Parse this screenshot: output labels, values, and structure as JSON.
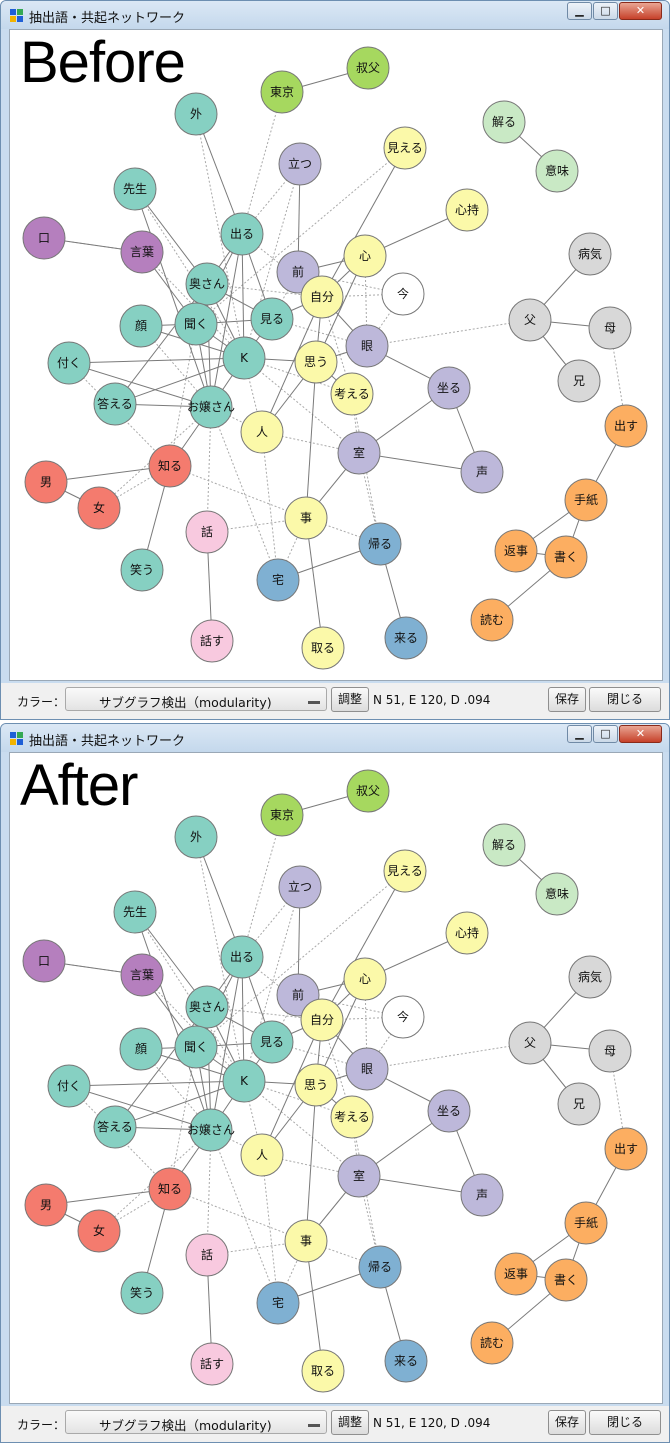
{
  "windows": [
    {
      "title": "抽出語・共起ネットワーク",
      "caption": "Before",
      "controls": {
        "minimize": "▁",
        "maximize": "□",
        "close": "✕"
      },
      "bottom": {
        "color_label": "カラー：",
        "color_value": "サブグラフ検出（modularity)",
        "adjust": "調整",
        "status": "N 51, E 120, D .094",
        "save": "保存",
        "close": "閉じる"
      }
    },
    {
      "title": "抽出語・共起ネットワーク",
      "caption": "After",
      "controls": {
        "minimize": "▁",
        "maximize": "□",
        "close": "✕"
      },
      "bottom": {
        "color_label": "カラー：",
        "color_value": "サブグラフ検出（modularity)",
        "adjust": "調整",
        "status": "N 51, E 120, D .094",
        "save": "保存",
        "close": "閉じる"
      }
    }
  ],
  "group_colors": {
    "teal": "#86d0c2",
    "purple": "#b57fbe",
    "lavender": "#bdb8da",
    "yellow": "#fbf9a9",
    "white": "#ffffff",
    "red": "#f47b6e",
    "pink": "#f8c9df",
    "blue": "#7fb0d2",
    "gray": "#d8d8d8",
    "orange": "#fcae61",
    "green": "#a6d85f",
    "lightgreen": "#c9e9c5"
  },
  "nodes": [
    {
      "id": "外",
      "label": "外",
      "group": "teal"
    },
    {
      "id": "東京",
      "label": "東京",
      "group": "green"
    },
    {
      "id": "叔父",
      "label": "叔父",
      "group": "green"
    },
    {
      "id": "解る",
      "label": "解る",
      "group": "lightgreen"
    },
    {
      "id": "意味",
      "label": "意味",
      "group": "lightgreen"
    },
    {
      "id": "先生",
      "label": "先生",
      "group": "teal"
    },
    {
      "id": "立つ",
      "label": "立つ",
      "group": "lavender"
    },
    {
      "id": "見える",
      "label": "見える",
      "group": "yellow"
    },
    {
      "id": "心持",
      "label": "心持",
      "group": "yellow"
    },
    {
      "id": "口",
      "label": "口",
      "group": "purple"
    },
    {
      "id": "言葉",
      "label": "言葉",
      "group": "purple"
    },
    {
      "id": "出る",
      "label": "出る",
      "group": "teal"
    },
    {
      "id": "心",
      "label": "心",
      "group": "yellow"
    },
    {
      "id": "病気",
      "label": "病気",
      "group": "gray"
    },
    {
      "id": "前",
      "label": "前",
      "group": "lavender"
    },
    {
      "id": "奥さん",
      "label": "奥さん",
      "group": "teal"
    },
    {
      "id": "自分",
      "label": "自分",
      "group": "yellow"
    },
    {
      "id": "今",
      "label": "今",
      "group": "white"
    },
    {
      "id": "父",
      "label": "父",
      "group": "gray"
    },
    {
      "id": "母",
      "label": "母",
      "group": "gray"
    },
    {
      "id": "顔",
      "label": "顔",
      "group": "teal"
    },
    {
      "id": "聞く",
      "label": "聞く",
      "group": "teal"
    },
    {
      "id": "見る",
      "label": "見る",
      "group": "teal"
    },
    {
      "id": "眼",
      "label": "眼",
      "group": "lavender"
    },
    {
      "id": "付く",
      "label": "付く",
      "group": "teal"
    },
    {
      "id": "K",
      "label": "K",
      "group": "teal"
    },
    {
      "id": "思う",
      "label": "思う",
      "group": "yellow"
    },
    {
      "id": "兄",
      "label": "兄",
      "group": "gray"
    },
    {
      "id": "考える",
      "label": "考える",
      "group": "yellow"
    },
    {
      "id": "坐る",
      "label": "坐る",
      "group": "lavender"
    },
    {
      "id": "答える",
      "label": "答える",
      "group": "teal"
    },
    {
      "id": "お嬢さん",
      "label": "お嬢さん",
      "group": "teal"
    },
    {
      "id": "出す",
      "label": "出す",
      "group": "orange"
    },
    {
      "id": "人",
      "label": "人",
      "group": "yellow"
    },
    {
      "id": "室",
      "label": "室",
      "group": "lavender"
    },
    {
      "id": "知る",
      "label": "知る",
      "group": "red"
    },
    {
      "id": "声",
      "label": "声",
      "group": "lavender"
    },
    {
      "id": "男",
      "label": "男",
      "group": "red"
    },
    {
      "id": "女",
      "label": "女",
      "group": "red"
    },
    {
      "id": "手紙",
      "label": "手紙",
      "group": "orange"
    },
    {
      "id": "話",
      "label": "話",
      "group": "pink"
    },
    {
      "id": "事",
      "label": "事",
      "group": "yellow"
    },
    {
      "id": "帰る",
      "label": "帰る",
      "group": "blue"
    },
    {
      "id": "返事",
      "label": "返事",
      "group": "orange"
    },
    {
      "id": "書く",
      "label": "書く",
      "group": "orange"
    },
    {
      "id": "笑う",
      "label": "笑う",
      "group": "teal"
    },
    {
      "id": "宅",
      "label": "宅",
      "group": "blue"
    },
    {
      "id": "読む",
      "label": "読む",
      "group": "orange"
    },
    {
      "id": "話す",
      "label": "話す",
      "group": "pink"
    },
    {
      "id": "取る",
      "label": "取る",
      "group": "yellow"
    },
    {
      "id": "来る",
      "label": "来る",
      "group": "blue"
    }
  ],
  "edges_solid": [
    [
      "東京",
      "叔父"
    ],
    [
      "解る",
      "意味"
    ],
    [
      "外",
      "出る"
    ],
    [
      "先生",
      "奥さん"
    ],
    [
      "先生",
      "お嬢さん"
    ],
    [
      "口",
      "言葉"
    ],
    [
      "言葉",
      "聞く"
    ],
    [
      "出る",
      "奥さん"
    ],
    [
      "出る",
      "聞く"
    ],
    [
      "出る",
      "見る"
    ],
    [
      "出る",
      "K"
    ],
    [
      "出る",
      "お嬢さん"
    ],
    [
      "立つ",
      "前"
    ],
    [
      "見える",
      "自分"
    ],
    [
      "心持",
      "心"
    ],
    [
      "心",
      "自分"
    ],
    [
      "心",
      "前"
    ],
    [
      "心",
      "思う"
    ],
    [
      "前",
      "自分"
    ],
    [
      "自分",
      "眼"
    ],
    [
      "自分",
      "思う"
    ],
    [
      "自分",
      "人"
    ],
    [
      "眼",
      "坐る"
    ],
    [
      "坐る",
      "声"
    ],
    [
      "坐る",
      "室"
    ],
    [
      "室",
      "声"
    ],
    [
      "室",
      "事"
    ],
    [
      "思う",
      "事"
    ],
    [
      "病気",
      "父"
    ],
    [
      "父",
      "母"
    ],
    [
      "父",
      "兄"
    ],
    [
      "奥さん",
      "聞く"
    ],
    [
      "奥さん",
      "見る"
    ],
    [
      "奥さん",
      "K"
    ],
    [
      "奥さん",
      "お嬢さん"
    ],
    [
      "奥さん",
      "答える"
    ],
    [
      "顔",
      "聞く"
    ],
    [
      "顔",
      "K"
    ],
    [
      "聞く",
      "見る"
    ],
    [
      "聞く",
      "K"
    ],
    [
      "聞く",
      "お嬢さん"
    ],
    [
      "付く",
      "K"
    ],
    [
      "付く",
      "お嬢さん"
    ],
    [
      "答える",
      "お嬢さん"
    ],
    [
      "答える",
      "K"
    ],
    [
      "K",
      "お嬢さん"
    ],
    [
      "K",
      "見る"
    ],
    [
      "見る",
      "自分"
    ],
    [
      "お嬢さん",
      "知る"
    ],
    [
      "知る",
      "男"
    ],
    [
      "男",
      "女"
    ],
    [
      "知る",
      "笑う"
    ],
    [
      "話",
      "話す"
    ],
    [
      "事",
      "取る"
    ],
    [
      "帰る",
      "宅"
    ],
    [
      "帰る",
      "来る"
    ],
    [
      "出す",
      "手紙"
    ],
    [
      "手紙",
      "返事"
    ],
    [
      "手紙",
      "書く"
    ],
    [
      "返事",
      "書く"
    ],
    [
      "書く",
      "読む"
    ],
    [
      "思う",
      "考える"
    ],
    [
      "人",
      "思う"
    ],
    [
      "K",
      "思う"
    ],
    [
      "眼",
      "思う"
    ]
  ],
  "edges_dotted": [
    [
      "東京",
      "出る"
    ],
    [
      "立つ",
      "出る"
    ],
    [
      "立つ",
      "K"
    ],
    [
      "見える",
      "聞く"
    ],
    [
      "今",
      "前"
    ],
    [
      "今",
      "自分"
    ],
    [
      "今",
      "眼"
    ],
    [
      "父",
      "眼"
    ],
    [
      "母",
      "出す"
    ],
    [
      "口",
      "言葉"
    ],
    [
      "言葉",
      "K"
    ],
    [
      "奥さん",
      "自分"
    ],
    [
      "顔",
      "お嬢さん"
    ],
    [
      "付く",
      "知る"
    ],
    [
      "お嬢さん",
      "女"
    ],
    [
      "お嬢さん",
      "話"
    ],
    [
      "お嬢さん",
      "宅"
    ],
    [
      "お嬢さん",
      "人"
    ],
    [
      "K",
      "室"
    ],
    [
      "K",
      "考える"
    ],
    [
      "K",
      "人"
    ],
    [
      "見る",
      "眼"
    ],
    [
      "人",
      "室"
    ],
    [
      "考える",
      "室"
    ],
    [
      "室",
      "帰る"
    ],
    [
      "思う",
      "眼"
    ],
    [
      "自分",
      "考える"
    ],
    [
      "話",
      "事"
    ],
    [
      "宅",
      "事"
    ],
    [
      "知る",
      "事"
    ],
    [
      "出る",
      "自分"
    ],
    [
      "前",
      "見る"
    ],
    [
      "心",
      "眼"
    ],
    [
      "事",
      "帰る"
    ],
    [
      "考える",
      "帰る"
    ],
    [
      "聞く",
      "知る"
    ],
    [
      "人",
      "宅"
    ],
    [
      "知る",
      "女"
    ],
    [
      "外",
      "K"
    ],
    [
      "先生",
      "K"
    ]
  ]
}
